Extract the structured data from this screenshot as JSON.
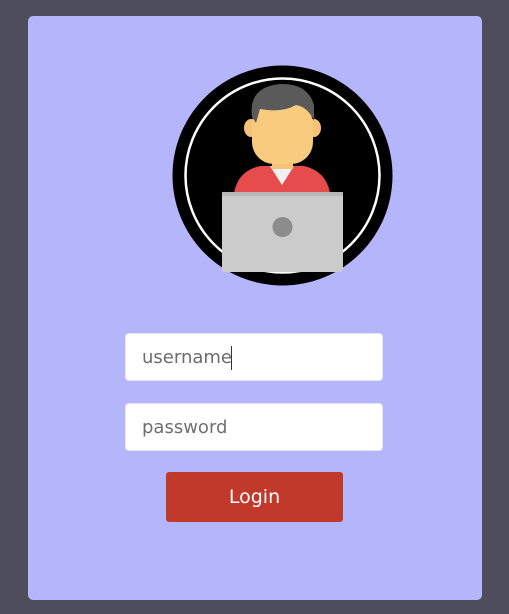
{
  "login_form": {
    "avatar_icon": "person-with-laptop-icon",
    "username": {
      "value": "username",
      "placeholder": "username"
    },
    "password": {
      "placeholder": "password"
    },
    "login_label": "Login"
  },
  "colors": {
    "page_background": "#4e4d5c",
    "card_background": "#b4b5fb",
    "button_background": "#c0392b",
    "button_text": "#ffffff"
  }
}
